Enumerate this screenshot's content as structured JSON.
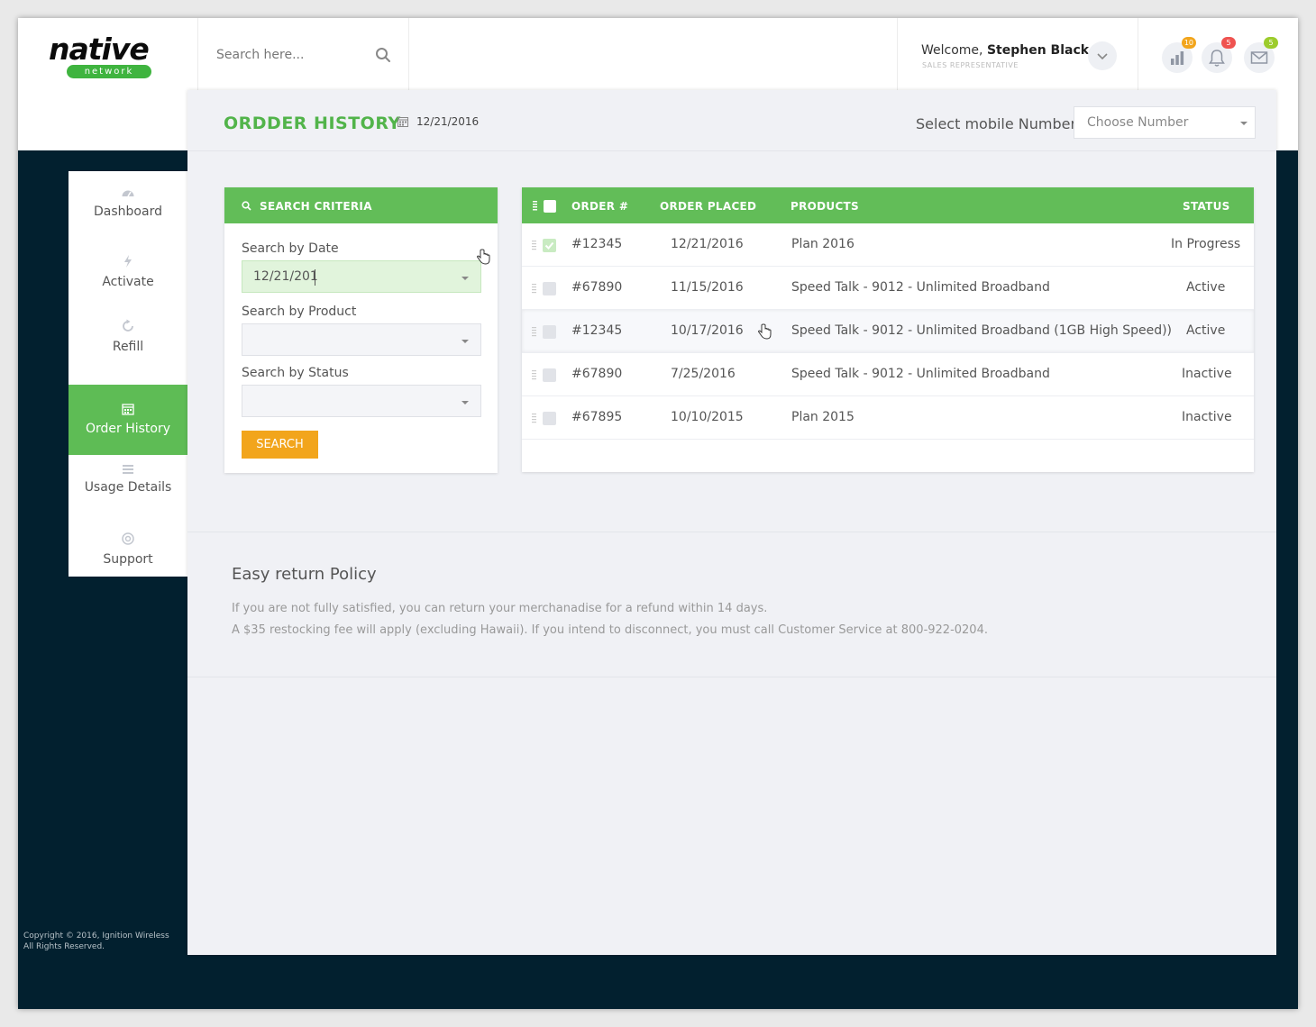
{
  "brand": {
    "logo_text": "native",
    "logo_tag": "network"
  },
  "search": {
    "placeholder": "Search here..."
  },
  "user": {
    "welcome_prefix": "Welcome,",
    "name": "Stephen Black",
    "role": "SALES REPRESENTATIVE"
  },
  "header_icons": [
    {
      "icon": "chart-icon",
      "badge": "10",
      "badge_color": "#f2a51c"
    },
    {
      "icon": "bell-icon",
      "badge": "5",
      "badge_color": "#ef5350"
    },
    {
      "icon": "mail-icon",
      "badge": "5",
      "badge_color": "#9ccc2c"
    }
  ],
  "sidebar": {
    "items": [
      {
        "label": "Dashboard",
        "icon": "gauge-icon"
      },
      {
        "label": "Activate",
        "icon": "bolt-icon"
      },
      {
        "label": "Refill",
        "icon": "refresh-icon"
      },
      {
        "label": "Order History",
        "icon": "calendar-icon",
        "active": true
      },
      {
        "label": "Usage Details",
        "icon": "list-icon"
      },
      {
        "label": "Support",
        "icon": "lifebuoy-icon"
      }
    ],
    "copyright_line1": "Copyright © 2016, Ignition Wireless",
    "copyright_line2": "All Rights Reserved."
  },
  "page": {
    "title": "ORDDER HISTORY",
    "date": "12/21/2016",
    "select_label": "Select mobile Number",
    "select_placeholder": "Choose Number"
  },
  "criteria": {
    "title": "SEARCH CRITERIA",
    "date_label": "Search by Date",
    "date_value": "12/21/201",
    "product_label": "Search by Product",
    "product_value": "",
    "status_label": "Search by Status",
    "status_value": "",
    "search_button": "SEARCH"
  },
  "orders": {
    "columns": {
      "order": "ORDER #",
      "placed": "ORDER PLACED",
      "products": "PRODUCTS",
      "status": "STATUS"
    },
    "rows": [
      {
        "order": "#12345",
        "placed": "12/21/2016",
        "product": "Plan 2016",
        "status": "In Progress",
        "checked": true
      },
      {
        "order": "#67890",
        "placed": "11/15/2016",
        "product": "Speed Talk - 9012 - Unlimited Broadband",
        "status": "Active",
        "checked": false
      },
      {
        "order": "#12345",
        "placed": "10/17/2016",
        "product": "Speed Talk - 9012 - Unlimited Broadband (1GB High Speed))",
        "status": "Active",
        "checked": false
      },
      {
        "order": "#67890",
        "placed": "7/25/2016",
        "product": "Speed Talk - 9012 - Unlimited Broadband",
        "status": "Inactive",
        "checked": false
      },
      {
        "order": "#67895",
        "placed": "10/10/2015",
        "product": "Plan 2015",
        "status": "Inactive",
        "checked": false
      }
    ]
  },
  "policy": {
    "title": "Easy return Policy",
    "line1": "If you are not fully satisfied, you can return your merchanadise for a refund within 14 days.",
    "line2": "A $35 restocking fee will apply (excluding Hawaii). If you intend to disconnect, you must call Customer Service at 800-922-0204."
  },
  "colors": {
    "accent_green": "#5ebc55",
    "sidebar_dark": "#02202f",
    "button_orange": "#f2a51c"
  }
}
